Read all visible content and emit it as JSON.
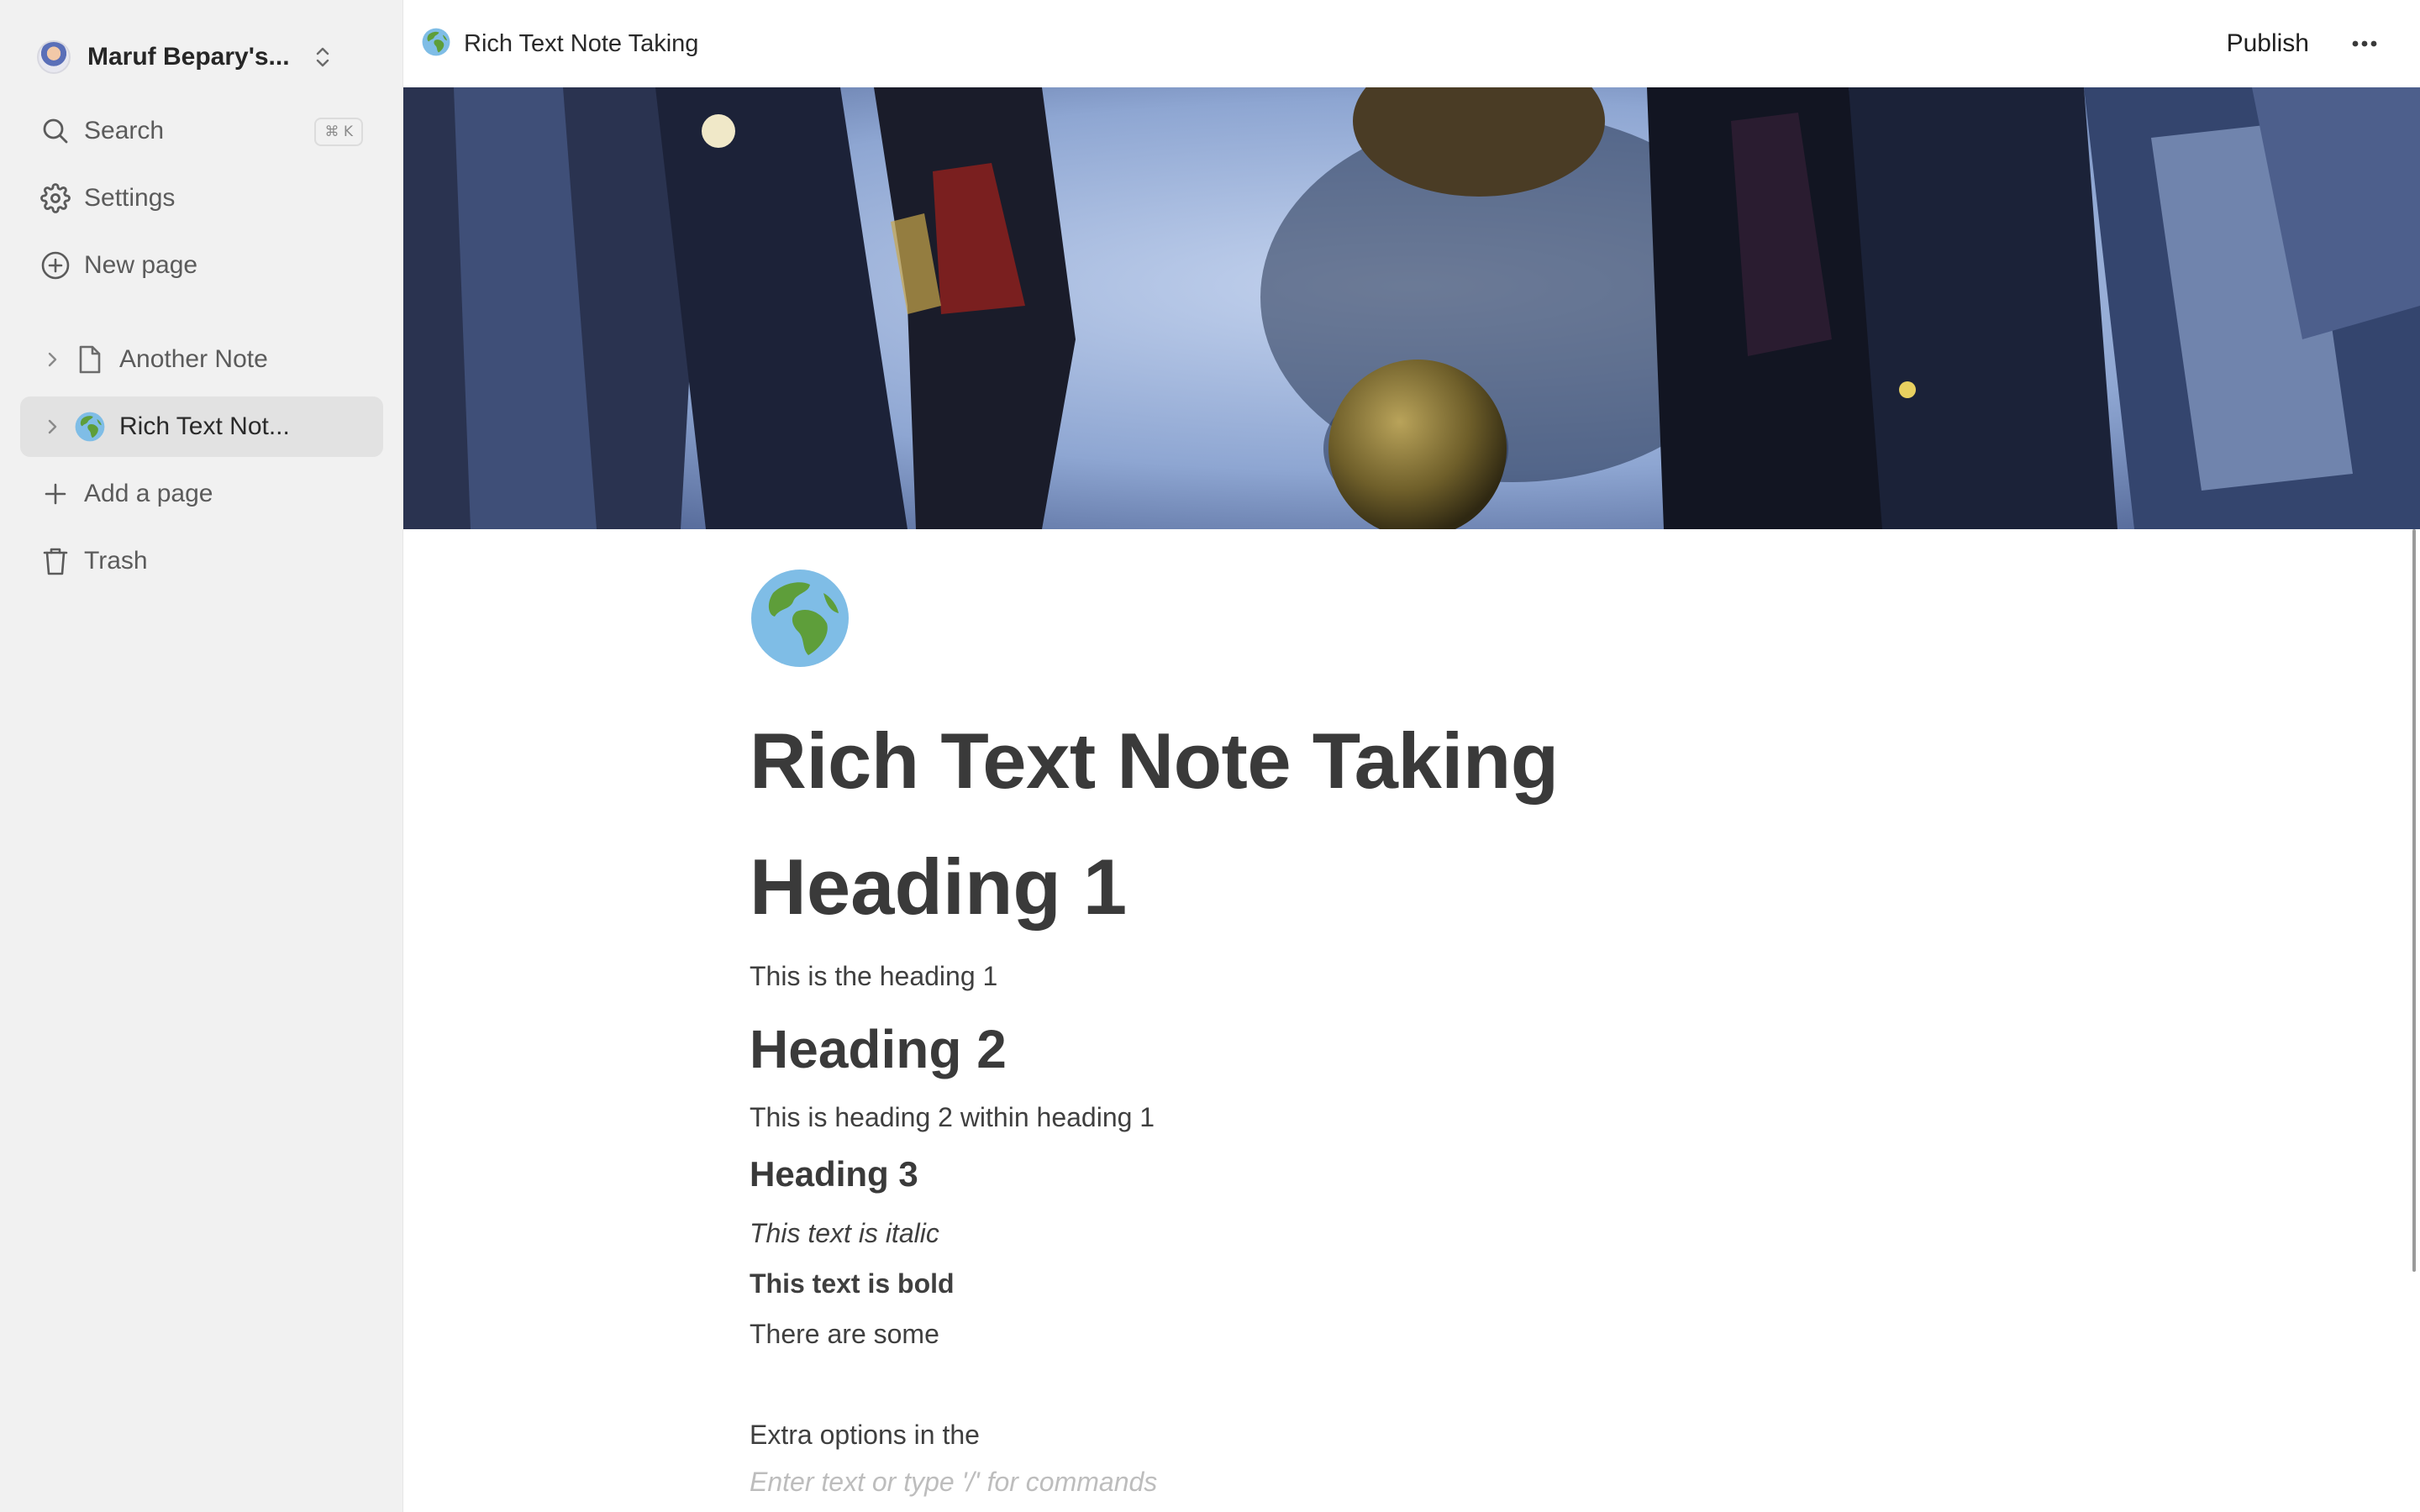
{
  "workspace": {
    "name": "Maruf Bepary's..."
  },
  "sidebar": {
    "search": {
      "label": "Search",
      "shortcut": "⌘ K",
      "icon": "search-icon"
    },
    "settings": {
      "label": "Settings",
      "icon": "gear-icon"
    },
    "new_page": {
      "label": "New page",
      "icon": "plus-circle-icon"
    },
    "pages": [
      {
        "label": "Another Note",
        "icon": "file-icon",
        "active": false
      },
      {
        "label": "Rich Text Not...",
        "icon": "globe-emoji-icon",
        "active": true
      }
    ],
    "add_page": {
      "label": "Add a page",
      "icon": "plus-icon"
    },
    "trash": {
      "label": "Trash",
      "icon": "trash-icon"
    }
  },
  "topbar": {
    "breadcrumb": "Rich Text Note Taking",
    "publish_label": "Publish",
    "more_icon": "more-horizontal-icon"
  },
  "document": {
    "icon": "globe-emoji-icon",
    "title": "Rich Text Note Taking",
    "heading1": "Heading 1",
    "para1": "This is the heading 1",
    "heading2": "Heading 2",
    "para2": "This is heading 2 within heading 1",
    "heading3": "Heading 3",
    "italic_text": "This text is italic",
    "bold_text": "This text is bold",
    "para3": "There are some",
    "para4": "Extra options in the",
    "placeholder": "Enter text or type '/' for commands"
  },
  "colors": {
    "sidebar_bg": "#f1f1f1",
    "active_item_bg": "#e2e2e2",
    "text": "#3f3f3f",
    "placeholder": "#bdbdbd"
  }
}
